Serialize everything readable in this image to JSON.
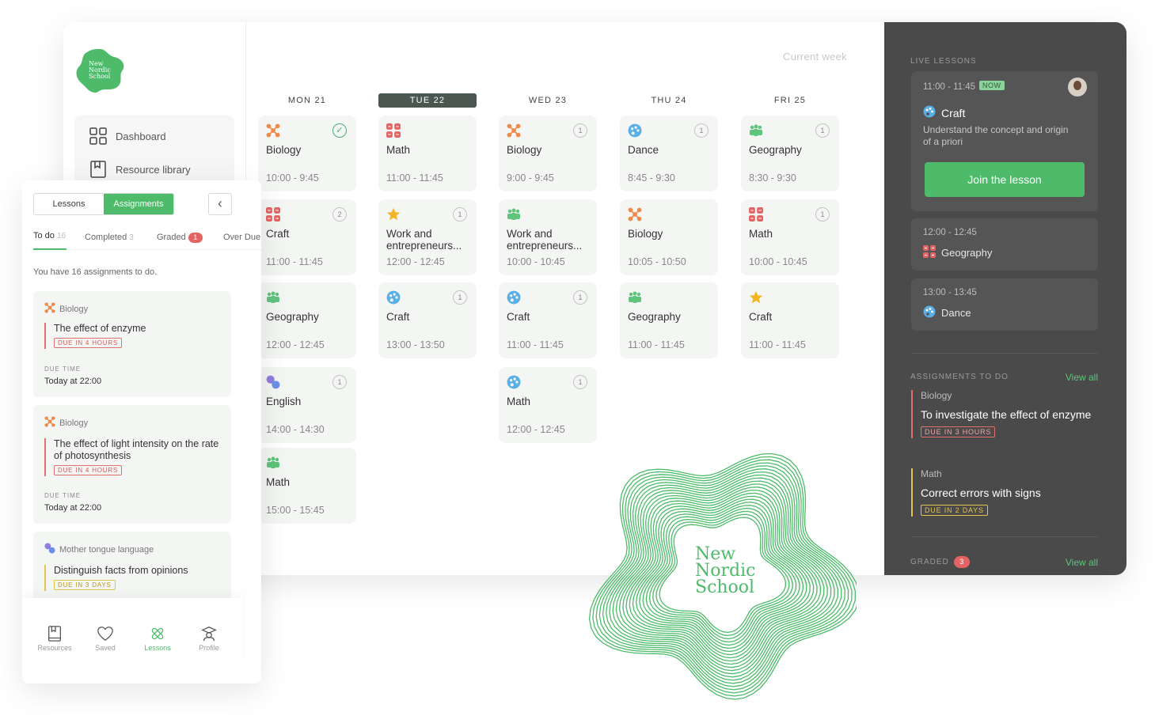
{
  "brand": {
    "name_line1": "New",
    "name_line2": "Nordic",
    "name_line3": "School",
    "color": "#4dbb6a"
  },
  "nav": {
    "dashboard": "Dashboard",
    "resource_library": "Resource library"
  },
  "schedule": {
    "header": "Current week",
    "days": [
      {
        "label": "MON 21",
        "active": false
      },
      {
        "label": "TUE 22",
        "active": true
      },
      {
        "label": "WED 23",
        "active": false
      },
      {
        "label": "THU 24",
        "active": false
      },
      {
        "label": "FRI 25",
        "active": false
      }
    ],
    "lessons": [
      [
        {
          "title": "Biology",
          "time": "10:00 - 9:45",
          "icon": "biology-icon",
          "badge": "✓"
        },
        {
          "title": "Craft",
          "time": "11:00 - 11:45",
          "icon": "math-icon",
          "badge": "2"
        },
        {
          "title": "Geography",
          "time": "12:00 - 12:45",
          "icon": "people-icon",
          "badge": ""
        },
        {
          "title": "English",
          "time": "14:00 - 14:30",
          "icon": "language-icon",
          "badge": "1"
        },
        {
          "title": "Math",
          "time": "15:00 - 15:45",
          "icon": "people-icon",
          "badge": ""
        }
      ],
      [
        {
          "title": "Math",
          "time": "11:00 - 11:45",
          "icon": "math-icon",
          "badge": ""
        },
        {
          "title": "Work and entrepreneurs...",
          "time": "12:00 - 12:45",
          "icon": "star-icon",
          "badge": "1"
        },
        {
          "title": "Craft",
          "time": "13:00 - 13:50",
          "icon": "palette-icon",
          "badge": "1"
        }
      ],
      [
        {
          "title": "Biology",
          "time": "9:00 - 9:45",
          "icon": "biology-icon",
          "badge": "1"
        },
        {
          "title": "Work and entrepreneurs...",
          "time": "10:00 - 10:45",
          "icon": "people-icon",
          "badge": ""
        },
        {
          "title": "Craft",
          "time": "11:00 - 11:45",
          "icon": "palette-icon",
          "badge": "1"
        },
        {
          "title": "Math",
          "time": "12:00 - 12:45",
          "icon": "palette-icon",
          "badge": "1"
        }
      ],
      [
        {
          "title": "Dance",
          "time": "8:45 - 9:30",
          "icon": "palette-icon",
          "badge": "1"
        },
        {
          "title": "Biology",
          "time": "10:05 - 10:50",
          "icon": "biology-icon",
          "badge": ""
        },
        {
          "title": "Geography",
          "time": "11:00 - 11:45",
          "icon": "people-icon",
          "badge": ""
        }
      ],
      [
        {
          "title": "Geography",
          "time": "8:30 - 9:30",
          "icon": "people-icon",
          "badge": "1"
        },
        {
          "title": "Math",
          "time": "10:00 - 10:45",
          "icon": "math-icon",
          "badge": "1"
        },
        {
          "title": "Craft",
          "time": "11:00 - 11:45",
          "icon": "star-icon",
          "badge": ""
        }
      ]
    ]
  },
  "live": {
    "section": "LIVE LESSONS",
    "current": {
      "time": "11:00 - 11:45",
      "now": "NOW",
      "name": "Craft",
      "description": "Understand the concept and origin of a priori",
      "join": "Join the lesson"
    },
    "next": [
      {
        "time": "12:00 - 12:45",
        "name": "Geography"
      },
      {
        "time": "13:00 - 13:45",
        "name": "Dance"
      }
    ]
  },
  "assignments_panel": {
    "section": "ASSIGNMENTS TO DO",
    "view_all": "View all",
    "items": [
      {
        "subject": "Biology",
        "title": "To investigate the effect of enzyme",
        "due": "DUE IN 3 HOURS"
      },
      {
        "subject": "Math",
        "title": "Correct errors with signs",
        "due": "DUE IN 2 DAYS"
      }
    ],
    "graded": "GRADED",
    "graded_count": "3",
    "graded_view_all": "View all"
  },
  "mobile": {
    "seg_lessons": "Lessons",
    "seg_assignments": "Assignments",
    "tabs": {
      "todo": "To do",
      "todo_count": "16",
      "completed": "Completed",
      "completed_count": "3",
      "graded": "Graded",
      "graded_count": "1",
      "overdue": "Over Due"
    },
    "summary": "You have 16 assignments to do.",
    "cards": [
      {
        "subject": "Biology",
        "title": "The effect of enzyme",
        "due": "DUE IN 4 HOURS",
        "due_label": "DUE TIME",
        "due_time": "Today at 22:00"
      },
      {
        "subject": "Biology",
        "title": "The effect of light intensity on the rate of photosynthesis",
        "due": "DUE IN 4 HOURS",
        "due_label": "DUE TIME",
        "due_time": "Today at 22:00"
      },
      {
        "subject": "Mother tongue language",
        "title": "Distinguish facts from opinions",
        "due": "DUE IN 3 DAYS"
      }
    ],
    "bottom_nav": [
      "Resources",
      "Saved",
      "Lessons",
      "Profile"
    ]
  }
}
